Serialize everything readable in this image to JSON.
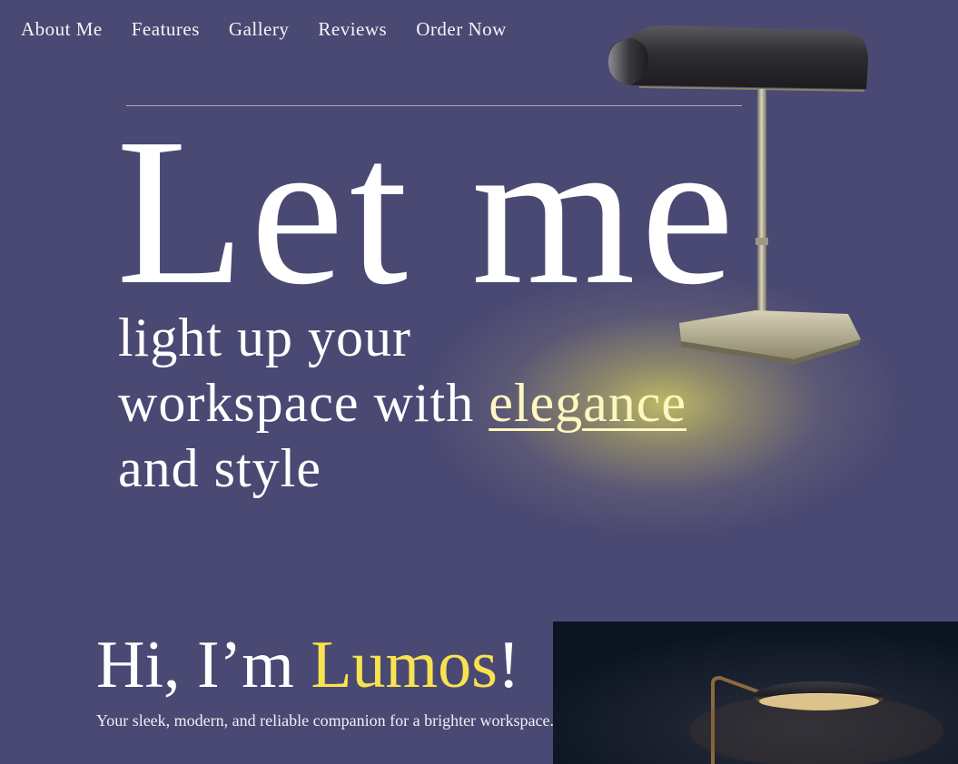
{
  "nav": {
    "items": [
      {
        "label": "About Me"
      },
      {
        "label": "Features"
      },
      {
        "label": "Gallery"
      },
      {
        "label": "Reviews"
      },
      {
        "label": "Order Now"
      }
    ]
  },
  "hero": {
    "headline": "Let me",
    "sub_line1": "light up your",
    "sub_line2_prefix": "workspace with ",
    "sub_line2_highlight": "elegance",
    "sub_line3": "and style"
  },
  "intro": {
    "title_prefix": "Hi, I’m ",
    "title_name": "Lumos",
    "title_suffix": "!",
    "subtitle": "Your sleek, modern, and reliable companion for a brighter workspace."
  },
  "colors": {
    "background": "#4a4973",
    "accent_yellow": "#f8e24e",
    "glow": "#c4be64",
    "photo_bg": "#0e1626"
  },
  "icons": {
    "desk_lamp": "desk-lamp-image",
    "floor_lamp_photo": "floor-lamp-photo"
  }
}
